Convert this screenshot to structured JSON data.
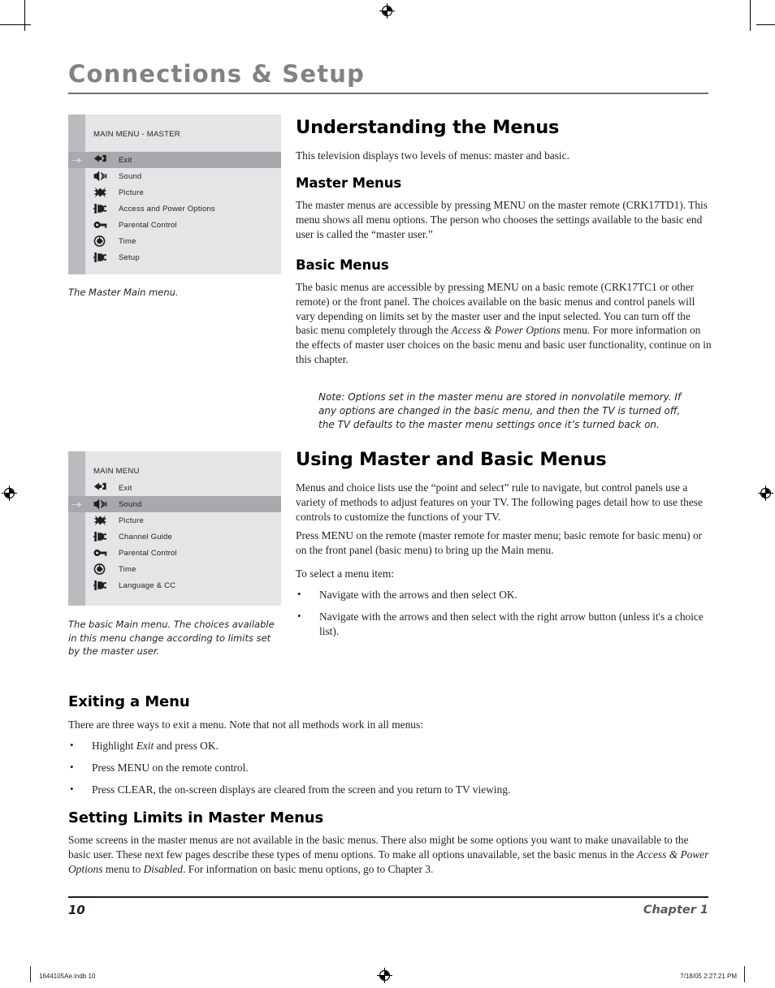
{
  "header": {
    "chapter_title": "Connections & Setup"
  },
  "figures": [
    {
      "name": "master-main-menu",
      "heading": "MAIN MENU - MASTER",
      "selected_index": 0,
      "items": [
        {
          "icon": "exit-arrow-icon",
          "label": "Exit"
        },
        {
          "icon": "speaker-sound-icon",
          "label": "Sound"
        },
        {
          "icon": "picture-icon",
          "label": "Picture"
        },
        {
          "icon": "plug-connector-icon",
          "label": "Access and Power Options"
        },
        {
          "icon": "key-lock-icon",
          "label": "Parental Control"
        },
        {
          "icon": "clock-icon",
          "label": "Time"
        },
        {
          "icon": "plug-connector-icon",
          "label": "Setup"
        }
      ],
      "caption": "The Master Main menu."
    },
    {
      "name": "basic-main-menu",
      "heading": "MAIN MENU",
      "selected_index": 1,
      "items": [
        {
          "icon": "exit-arrow-icon",
          "label": "Exit"
        },
        {
          "icon": "speaker-sound-icon",
          "label": "Sound"
        },
        {
          "icon": "picture-icon",
          "label": "Picture"
        },
        {
          "icon": "plug-connector-icon",
          "label": "Channel Guide"
        },
        {
          "icon": "key-lock-icon",
          "label": "Parental Control"
        },
        {
          "icon": "clock-icon",
          "label": "Time"
        },
        {
          "icon": "plug-connector-icon",
          "label": "Language & CC"
        }
      ],
      "caption": "The basic Main menu. The choices available in this menu change according to limits set by the master user."
    }
  ],
  "sections": {
    "understanding": {
      "heading": "Understanding the Menus",
      "intro": "This television displays two levels of menus: master and basic."
    },
    "master_menus": {
      "heading": "Master Menus",
      "body": "The master menus are accessible by pressing MENU on the master remote (CRK17TD1). This menu shows all menu options. The person who chooses the settings available to the basic end user is called the “master user.”"
    },
    "basic_menus": {
      "heading": "Basic Menus",
      "body_part1": "The basic menus are accessible by pressing MENU on a basic remote (CRK17TC1 or other remote) or the front panel. The choices available on the basic menus and control panels will vary depending on limits set by the master user and the input selected. You can turn off the basic menu completely through the ",
      "body_italic": "Access & Power Options",
      "body_part2": " menu. For more information on the effects of master user choices on the basic menu and basic user functionality, continue on in this chapter.",
      "note": "Note: Options set in the master menu are stored in nonvolatile memory. If any options are changed in the basic menu, and then the TV is turned off, the TV defaults to the master menu settings once it’s turned back on."
    },
    "using_menus": {
      "heading": "Using Master and Basic Menus",
      "para1": "Menus and choice lists use the “point and select” rule to navigate, but control panels use a variety of methods to adjust features on your TV. The following pages detail how to use these controls to customize the functions of your TV.",
      "para2": "Press MENU on the remote (master remote for master menu; basic remote for basic menu) or on the front panel (basic menu) to bring up the Main menu.",
      "para3": "To select a menu item:",
      "bullets": [
        "Navigate with the arrows and then select OK.",
        "Navigate with the arrows and then select with the right arrow button (unless it's a choice list)."
      ]
    },
    "exiting": {
      "heading": "Exiting a Menu",
      "intro": "There are three ways to exit a menu. Note that not all methods work in all menus:",
      "bullet1_pre": "Highlight ",
      "bullet1_italic": "Exit",
      "bullet1_post": " and press OK.",
      "bullet2": "Press MENU on the remote control.",
      "bullet3": "Press CLEAR, the on-screen displays are cleared from the screen and you return to TV viewing."
    },
    "setting_limits": {
      "heading": "Setting Limits in Master Menus",
      "part1": "Some screens in the master menus are not available in the basic menus. There also might be some options you want to make unavailable to the basic user. These next few pages describe these types of menu options. To make all options unavailable, set the basic menus in the ",
      "italic1": "Access & Power Options",
      "part2": " menu to ",
      "italic2": "Disabled",
      "part3": ". For information on basic menu options, go to Chapter 3."
    }
  },
  "footer": {
    "page_number": "10",
    "chapter_label": "Chapter 1",
    "slug_left": "1644105Ae.indb   10",
    "slug_right": "7/18/05   2:27:21 PM"
  }
}
